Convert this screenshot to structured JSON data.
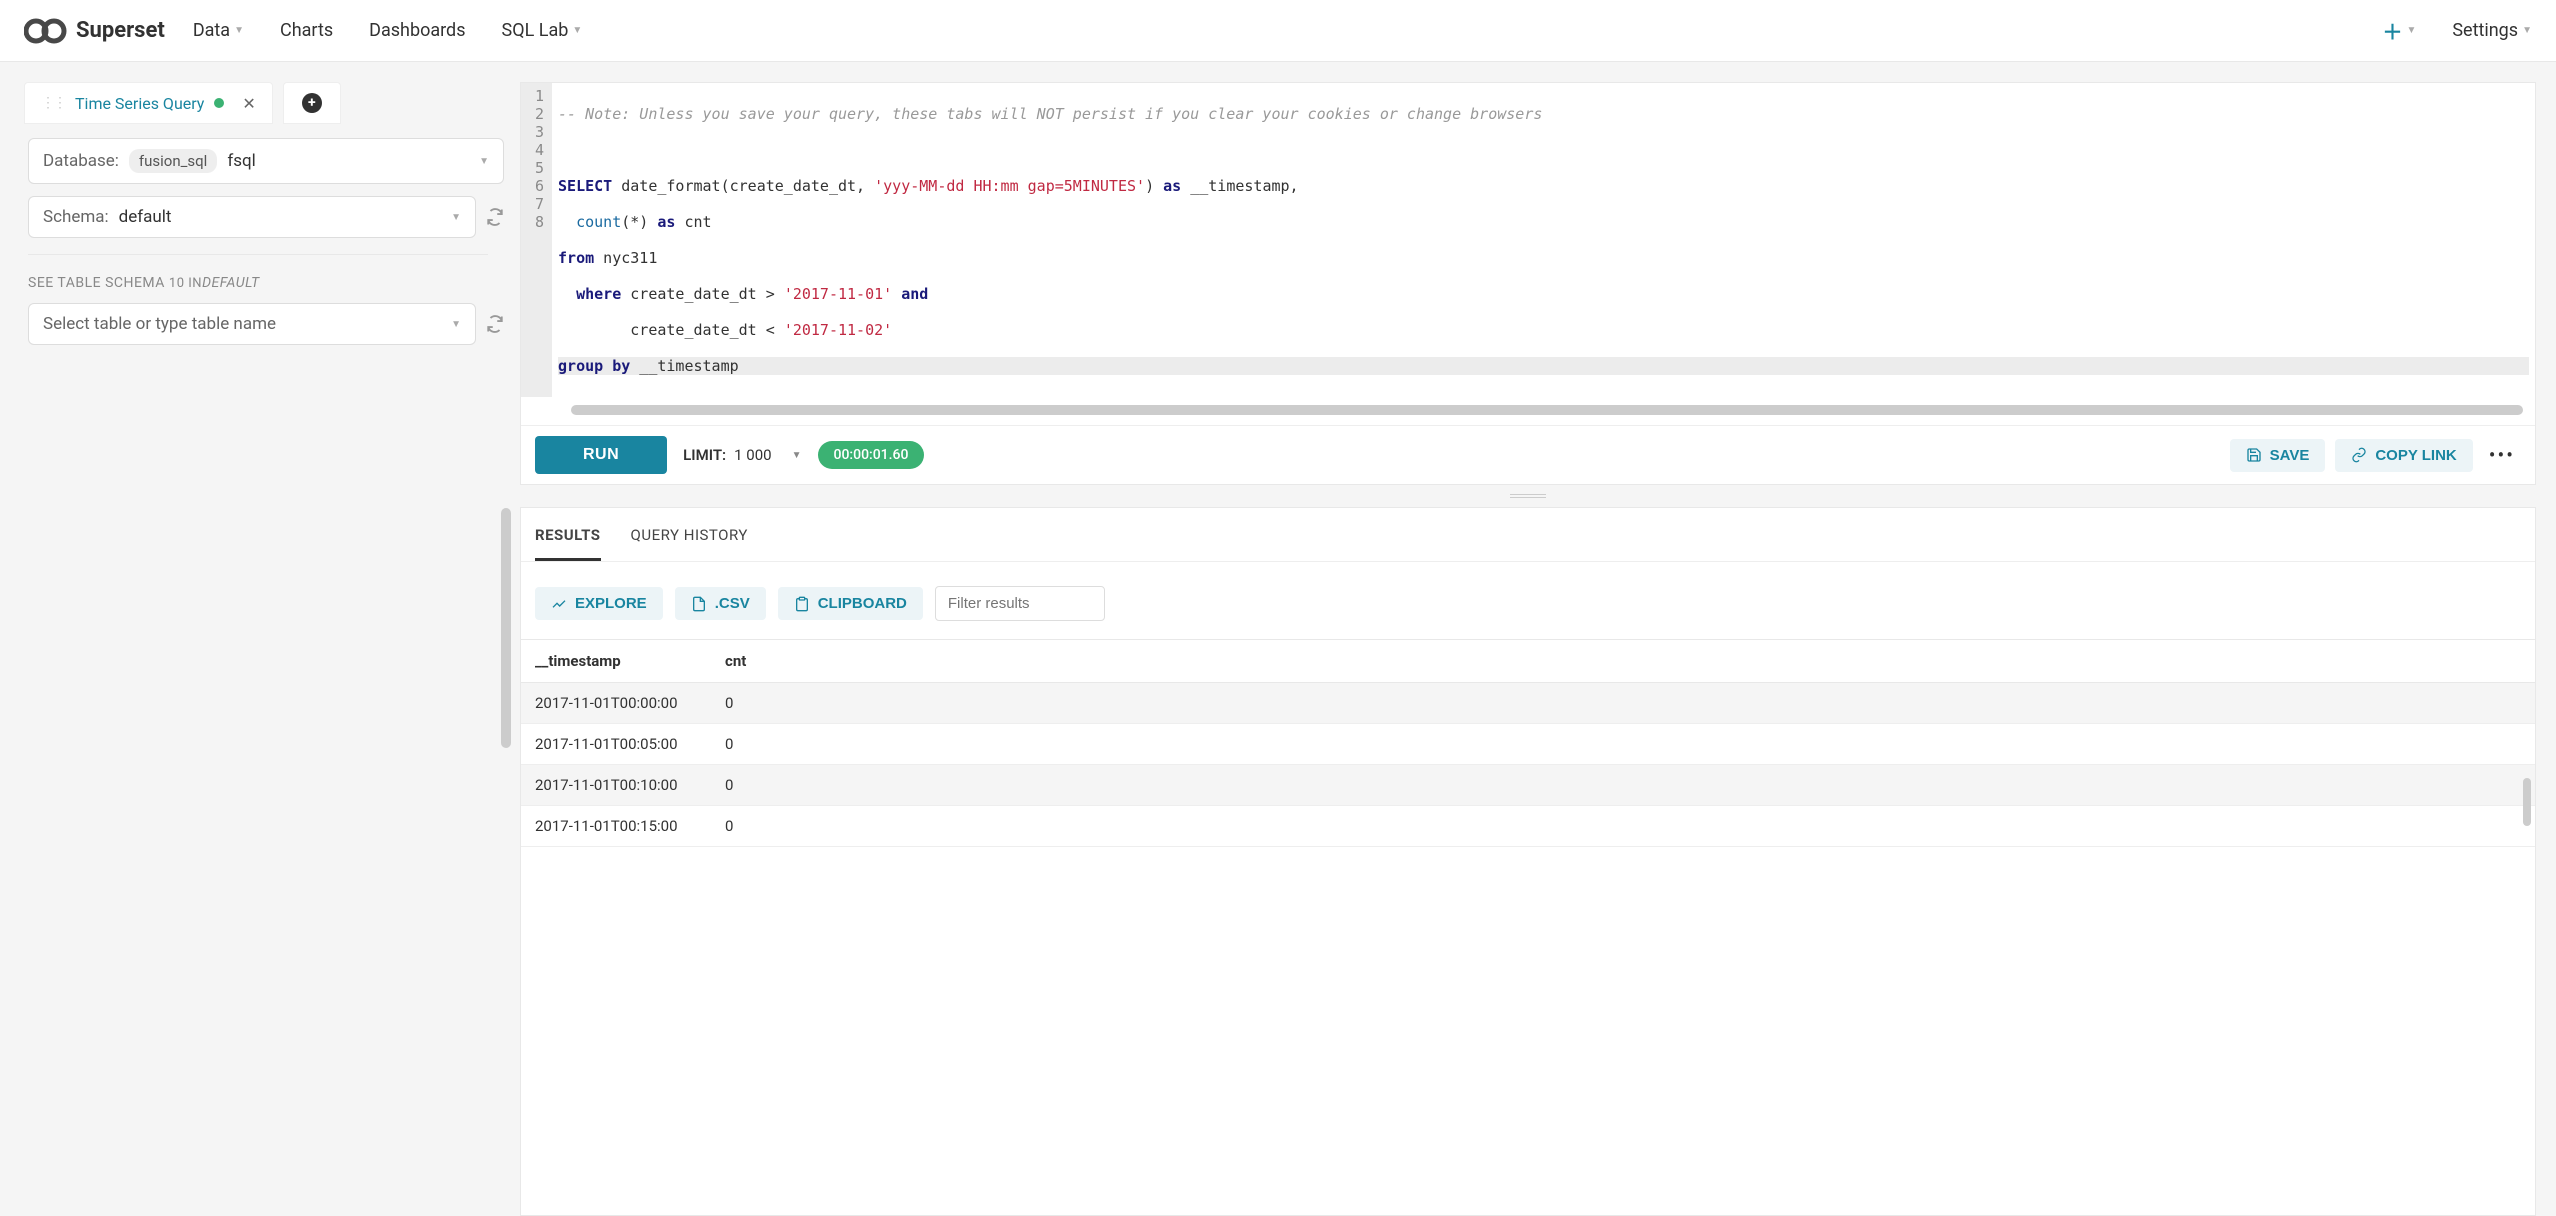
{
  "brand": "Superset",
  "nav": {
    "data": "Data",
    "charts": "Charts",
    "dashboards": "Dashboards",
    "sql_lab": "SQL Lab",
    "settings": "Settings"
  },
  "tab": {
    "title": "Time Series Query"
  },
  "database": {
    "label": "Database:",
    "tag": "fusion_sql",
    "value": "fsql"
  },
  "schema": {
    "label": "Schema:",
    "value": "default"
  },
  "table_section": {
    "label": "SEE TABLE SCHEMA",
    "count": "10 IN",
    "scope": "DEFAULT",
    "placeholder": "Select table or type table name"
  },
  "editor": {
    "comment": "-- Note: Unless you save your query, these tabs will NOT persist if you clear your cookies or change browsers",
    "line3_a": "SELECT",
    "line3_b": " date_format(create_date_dt, ",
    "line3_str": "'yyy-MM-dd HH:mm gap=5MINUTES'",
    "line3_c": ") ",
    "line3_as": "as",
    "line3_d": " __timestamp,",
    "line4_fn": "count",
    "line4_a": "(*) ",
    "line4_as": "as",
    "line4_b": " cnt",
    "line5_from": "from",
    "line5_tbl": " nyc311",
    "line6_where": "where",
    "line6_a": " create_date_dt > ",
    "line6_str": "'2017-11-01'",
    "line6_and": "and",
    "line7_a": "create_date_dt < ",
    "line7_str": "'2017-11-02'",
    "line8_group": "group",
    "line8_by": "by",
    "line8_col": " __timestamp"
  },
  "toolbar": {
    "run": "RUN",
    "limit_label": "LIMIT:",
    "limit_value": "1 000",
    "timer": "00:00:01.60",
    "save": "SAVE",
    "copy_link": "COPY LINK"
  },
  "results": {
    "tabs": {
      "results": "RESULTS",
      "history": "QUERY HISTORY"
    },
    "actions": {
      "explore": "EXPLORE",
      "csv": ".CSV",
      "clipboard": "CLIPBOARD"
    },
    "filter_placeholder": "Filter results",
    "columns": {
      "ts": "__timestamp",
      "cnt": "cnt"
    },
    "rows": [
      {
        "ts": "2017-11-01T00:00:00",
        "cnt": "0"
      },
      {
        "ts": "2017-11-01T00:05:00",
        "cnt": "0"
      },
      {
        "ts": "2017-11-01T00:10:00",
        "cnt": "0"
      },
      {
        "ts": "2017-11-01T00:15:00",
        "cnt": "0"
      }
    ]
  }
}
